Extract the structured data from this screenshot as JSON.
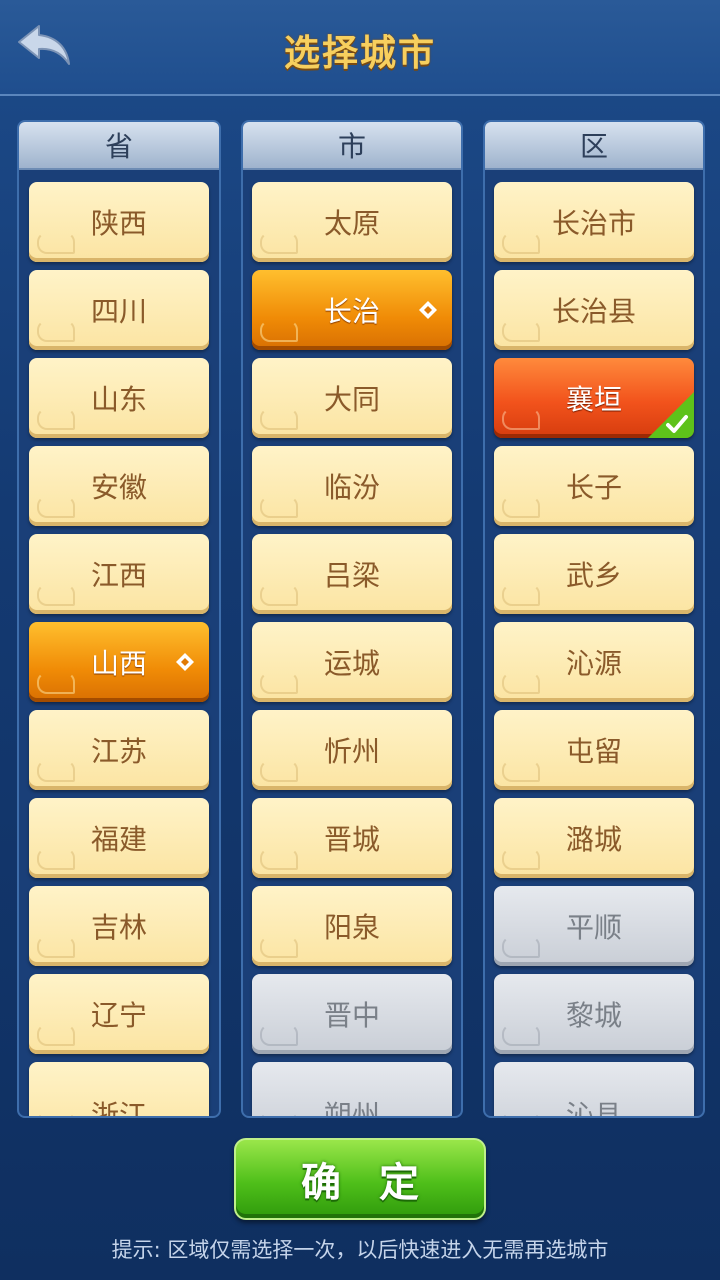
{
  "header": {
    "title": "选择城市",
    "back_icon": "back-arrow-icon"
  },
  "columns": {
    "province": {
      "title": "省",
      "items": [
        "陕西",
        "四川",
        "山东",
        "安徽",
        "江西",
        "山西",
        "江苏",
        "福建",
        "吉林",
        "辽宁",
        "浙江"
      ],
      "selected": "山西"
    },
    "city": {
      "title": "市",
      "items": [
        "太原",
        "长治",
        "大同",
        "临汾",
        "吕梁",
        "运城",
        "忻州",
        "晋城",
        "阳泉",
        "晋中",
        "朔州"
      ],
      "selected": "长治"
    },
    "district": {
      "title": "区",
      "items": [
        "长治市",
        "长治县",
        "襄垣",
        "长子",
        "武乡",
        "沁源",
        "屯留",
        "潞城",
        "平顺",
        "黎城",
        "沁县"
      ],
      "selected": "襄垣"
    }
  },
  "confirm": {
    "label": "确定"
  },
  "hint": "提示: 区域仅需选择一次，以后快速进入无需再选城市",
  "colors": {
    "accent_title": "#f7cf5e",
    "selected_orange": "#f08b06",
    "selected_red": "#f2531c",
    "confirm_green": "#4fbf1a",
    "item_normal": "#fbe4a2",
    "item_disabled": "#c9ced6"
  }
}
